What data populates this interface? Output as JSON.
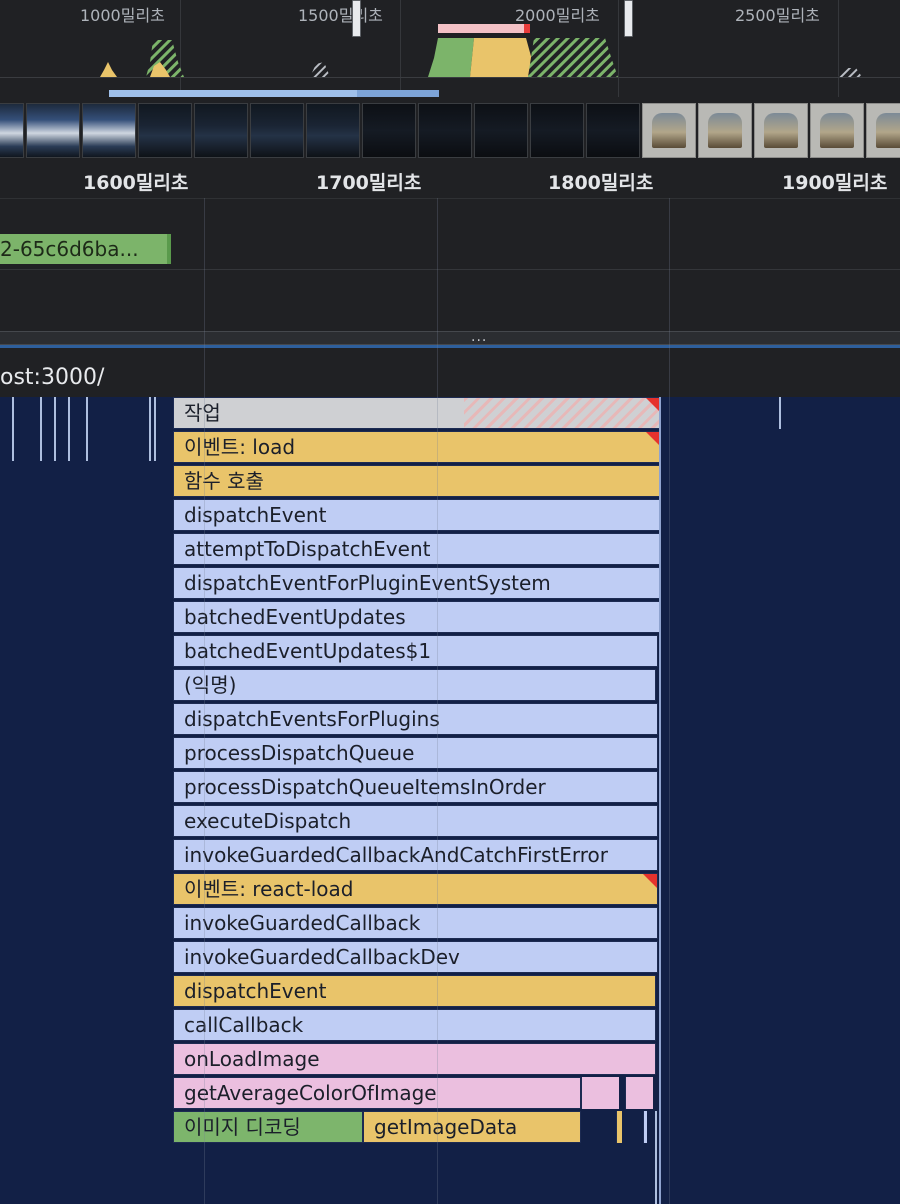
{
  "overview": {
    "ticks": [
      "1000밀리초",
      "1500밀리초",
      "2000밀리초",
      "2500밀리초"
    ]
  },
  "ruler": {
    "ticks": [
      "1600밀리초",
      "1700밀리초",
      "1800밀리초",
      "1900밀리초"
    ]
  },
  "network": {
    "request_label": "2-65c6d6ba..."
  },
  "divider": {
    "grip": "..."
  },
  "main_thread": {
    "title": "ost:3000/"
  },
  "flame_rows": [
    {
      "label": "작업",
      "color": "#cfd0d3",
      "warning": true
    },
    {
      "label": "이벤트: load",
      "color": "#e9c46a",
      "warning": true
    },
    {
      "label": "함수 호출",
      "color": "#e9c46a",
      "warning": false
    },
    {
      "label": "dispatchEvent",
      "color": "#bfcdf4",
      "warning": false
    },
    {
      "label": "attemptToDispatchEvent",
      "color": "#bfcdf4",
      "warning": false
    },
    {
      "label": "dispatchEventForPluginEventSystem",
      "color": "#bfcdf4",
      "warning": false
    },
    {
      "label": "batchedEventUpdates",
      "color": "#bfcdf4",
      "warning": false
    },
    {
      "label": "batchedEventUpdates$1",
      "color": "#bfcdf4",
      "warning": false
    },
    {
      "label": "(익명)",
      "color": "#bfcdf4",
      "warning": false
    },
    {
      "label": "dispatchEventsForPlugins",
      "color": "#bfcdf4",
      "warning": false
    },
    {
      "label": "processDispatchQueue",
      "color": "#bfcdf4",
      "warning": false
    },
    {
      "label": "processDispatchQueueItemsInOrder",
      "color": "#bfcdf4",
      "warning": false
    },
    {
      "label": "executeDispatch",
      "color": "#bfcdf4",
      "warning": false
    },
    {
      "label": "invokeGuardedCallbackAndCatchFirstError",
      "color": "#bfcdf4",
      "warning": false
    },
    {
      "label": "이벤트: react-load",
      "color": "#e9c46a",
      "warning": true
    },
    {
      "label": "invokeGuardedCallback",
      "color": "#bfcdf4",
      "warning": false
    },
    {
      "label": "invokeGuardedCallbackDev",
      "color": "#bfcdf4",
      "warning": false
    },
    {
      "label": "dispatchEvent",
      "color": "#e9c46a",
      "warning": false
    },
    {
      "label": "callCallback",
      "color": "#bfcdf4",
      "warning": false
    },
    {
      "label": "onLoadImage",
      "color": "#ebbfdf",
      "warning": false
    },
    {
      "label": "getAverageColorOfImage",
      "color": "#ebbfdf",
      "warning": false
    }
  ],
  "bottom_row": {
    "decode_label": "이미지 디코딩",
    "get_image_data_label": "getImageData"
  }
}
